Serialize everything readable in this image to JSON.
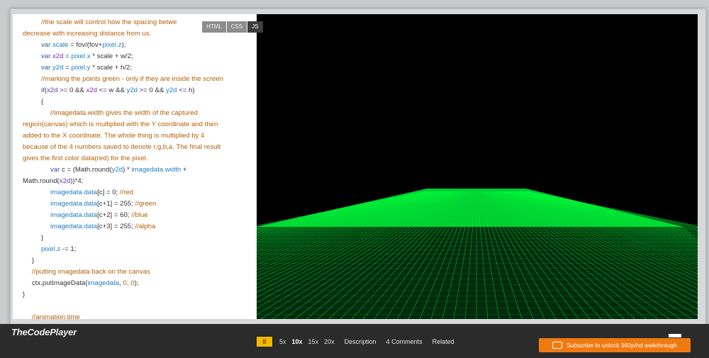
{
  "app": {
    "logo": "TheCodePlayer"
  },
  "tabs": [
    "HTML",
    "CSS",
    "JS"
  ],
  "code_lines": [
    {
      "indent": 2,
      "parts": [
        {
          "c": "cm",
          "t": "//the scale will control how the spacing betwe"
        }
      ]
    },
    {
      "indent": 0,
      "parts": [
        {
          "c": "cm",
          "t": "decrease with increasing distance from us."
        }
      ]
    },
    {
      "indent": 2,
      "parts": [
        {
          "c": "kw",
          "t": "var "
        },
        {
          "c": "id",
          "t": "scale"
        },
        {
          "c": "op",
          "t": " = fov/(fov+"
        },
        {
          "c": "id",
          "t": "pixel.z"
        },
        {
          "c": "op",
          "t": ");"
        }
      ]
    },
    {
      "indent": 2,
      "parts": [
        {
          "c": "kw",
          "t": "var "
        },
        {
          "c": "pv",
          "t": "x2d"
        },
        {
          "c": "op",
          "t": " = "
        },
        {
          "c": "id",
          "t": "pixel.x"
        },
        {
          "c": "op",
          "t": " * scale + w/2;"
        }
      ]
    },
    {
      "indent": 2,
      "parts": [
        {
          "c": "kw",
          "t": "var "
        },
        {
          "c": "id",
          "t": "y2d"
        },
        {
          "c": "op",
          "t": " = "
        },
        {
          "c": "id",
          "t": "pixel.y"
        },
        {
          "c": "op",
          "t": " * scale + h/2;"
        }
      ]
    },
    {
      "indent": 2,
      "parts": [
        {
          "c": "cm",
          "t": "//marking the points green - only if they are inside the screen"
        }
      ]
    },
    {
      "indent": 2,
      "parts": [
        {
          "c": "kw",
          "t": "if"
        },
        {
          "c": "op",
          "t": "("
        },
        {
          "c": "pv",
          "t": "x2d"
        },
        {
          "c": "op",
          "t": " >= 0 && "
        },
        {
          "c": "pv",
          "t": "x2d"
        },
        {
          "c": "op",
          "t": " <= w && "
        },
        {
          "c": "id",
          "t": "y2d"
        },
        {
          "c": "op",
          "t": " >= 0 && "
        },
        {
          "c": "id",
          "t": "y2d"
        },
        {
          "c": "op",
          "t": " <= h)"
        }
      ]
    },
    {
      "indent": 2,
      "parts": [
        {
          "c": "op",
          "t": "{"
        }
      ]
    },
    {
      "indent": 3,
      "parts": [
        {
          "c": "cm",
          "t": "//imagedata.width gives the width of the captured"
        }
      ]
    },
    {
      "indent": 0,
      "parts": [
        {
          "c": "cm",
          "t": "region(canvas) which is multiplied with the Y coordinate and then"
        }
      ]
    },
    {
      "indent": 0,
      "parts": [
        {
          "c": "cm",
          "t": "added to the X coordinate. The whole thing is multiplied by 4"
        }
      ]
    },
    {
      "indent": 0,
      "parts": [
        {
          "c": "cm",
          "t": "because of the 4 numbers saved to denote r,g,b,a. The final result"
        }
      ]
    },
    {
      "indent": 0,
      "parts": [
        {
          "c": "cm",
          "t": "gives the first color data(red) for the pixel."
        }
      ]
    },
    {
      "indent": 3,
      "parts": [
        {
          "c": "kw",
          "t": "var "
        },
        {
          "c": "op",
          "t": "c = (Math.round("
        },
        {
          "c": "id",
          "t": "y2d"
        },
        {
          "c": "op",
          "t": ") * "
        },
        {
          "c": "id",
          "t": "imagedata.width"
        },
        {
          "c": "op",
          "t": " +"
        }
      ]
    },
    {
      "indent": 0,
      "parts": [
        {
          "c": "op",
          "t": "Math.round("
        },
        {
          "c": "pv",
          "t": "x2d"
        },
        {
          "c": "op",
          "t": "))*4;"
        }
      ]
    },
    {
      "indent": 3,
      "parts": [
        {
          "c": "id",
          "t": "imagedata.data"
        },
        {
          "c": "op",
          "t": "[c] = 0; "
        },
        {
          "c": "cm",
          "t": "//red"
        }
      ]
    },
    {
      "indent": 3,
      "parts": [
        {
          "c": "id",
          "t": "imagedata.data"
        },
        {
          "c": "op",
          "t": "[c+1] = 255; "
        },
        {
          "c": "cm",
          "t": "//green"
        }
      ]
    },
    {
      "indent": 3,
      "parts": [
        {
          "c": "id",
          "t": "imagedata.data"
        },
        {
          "c": "op",
          "t": "[c+2] = 60; "
        },
        {
          "c": "cm",
          "t": "//blue"
        }
      ]
    },
    {
      "indent": 3,
      "parts": [
        {
          "c": "id",
          "t": "imagedata.data"
        },
        {
          "c": "op",
          "t": "[c+3] = 255; "
        },
        {
          "c": "cm",
          "t": "//alpha"
        }
      ]
    },
    {
      "indent": 2,
      "parts": [
        {
          "c": "op",
          "t": "}"
        }
      ]
    },
    {
      "indent": 2,
      "parts": [
        {
          "c": "id",
          "t": "pixel.z"
        },
        {
          "c": "op",
          "t": " -= 1;"
        }
      ]
    },
    {
      "indent": 1,
      "parts": [
        {
          "c": "op",
          "t": "}"
        }
      ]
    },
    {
      "indent": 1,
      "parts": [
        {
          "c": "cm",
          "t": "//putting imagedata back on the canvas"
        }
      ]
    },
    {
      "indent": 1,
      "parts": [
        {
          "c": "op",
          "t": "ctx.putImageData("
        },
        {
          "c": "id",
          "t": "imagedata"
        },
        {
          "c": "op",
          "t": ", "
        },
        {
          "c": "num",
          "t": "0, 0"
        },
        {
          "c": "op",
          "t": ");"
        }
      ]
    },
    {
      "indent": 0,
      "parts": [
        {
          "c": "op",
          "t": "}"
        }
      ]
    },
    {
      "indent": 0,
      "parts": [
        {
          "c": "op",
          "t": ""
        }
      ]
    },
    {
      "indent": 1,
      "parts": [
        {
          "c": "cm",
          "t": "//animation time"
        }
      ]
    }
  ],
  "playback": {
    "play_label": "II",
    "speeds": [
      "5x",
      "10x",
      "15x",
      "20x"
    ],
    "active_speed": "10x",
    "progress_fraction": 0.98
  },
  "links": {
    "description": "Description",
    "comments": "4 Comments",
    "related": "Related"
  },
  "subscribe": {
    "label": "Subscribe to unlock 360p/hd walkthrough"
  },
  "colors": {
    "canvas_bg": "#000000",
    "pixel_green": "#00ff3c",
    "play_button": "#f5b800",
    "subscribe": "#f07a12",
    "bottom_bar": "#2b2b2b"
  },
  "icons": {
    "scroll_up": "triangle-up-icon",
    "scroll_down": "triangle-down-icon",
    "subscribe": "video-icon"
  }
}
